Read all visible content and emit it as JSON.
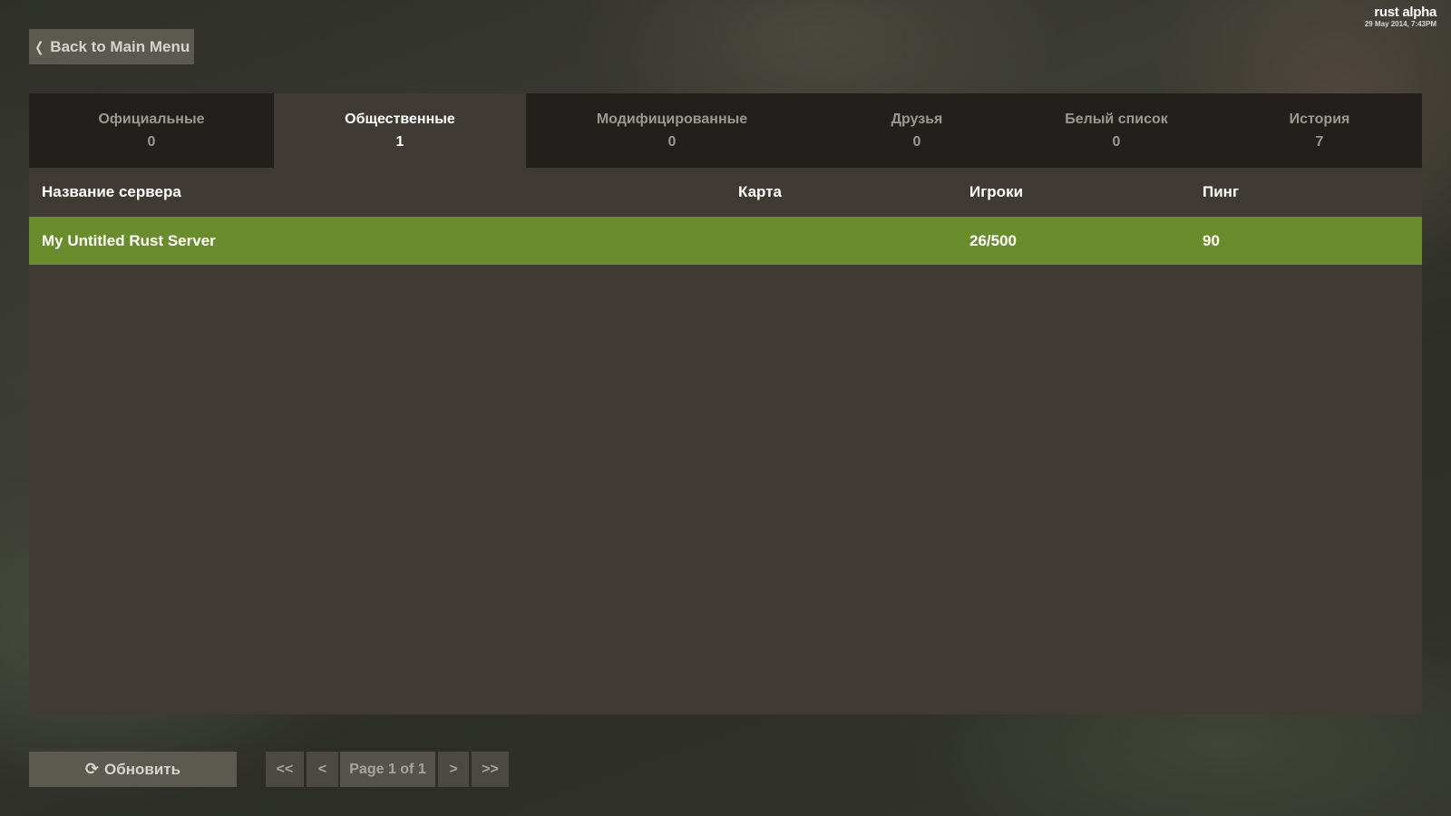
{
  "brand": {
    "title": "rust alpha",
    "date": "29 May 2014, 7:43PM"
  },
  "back_button": {
    "icon": "chevron-left-icon",
    "label": "Back to Main Menu"
  },
  "tabs": [
    {
      "label": "Официальные",
      "count": "0",
      "active": false
    },
    {
      "label": "Общественные",
      "count": "1",
      "active": true
    },
    {
      "label": "Модифицированные",
      "count": "0",
      "active": false
    },
    {
      "label": "Друзья",
      "count": "0",
      "active": false
    },
    {
      "label": "Белый список",
      "count": "0",
      "active": false
    },
    {
      "label": "История",
      "count": "7",
      "active": false
    }
  ],
  "table": {
    "headers": {
      "name": "Название сервера",
      "map": "Карта",
      "players": "Игроки",
      "ping": "Пинг"
    },
    "rows": [
      {
        "name": "My Untitled Rust Server",
        "map": "",
        "players": "26/500",
        "ping": "90",
        "selected": true
      }
    ]
  },
  "footer": {
    "refresh_icon": "refresh-icon",
    "refresh_label": "Обновить",
    "pager": {
      "first": "<<",
      "prev": "<",
      "label": "Page 1 of 1",
      "next": ">",
      "last": ">>"
    }
  },
  "colors": {
    "selected_row": "#6a8c2d",
    "panel": "#3f3a34",
    "tab_bar": "#221f1c",
    "button": "#5b5950"
  }
}
